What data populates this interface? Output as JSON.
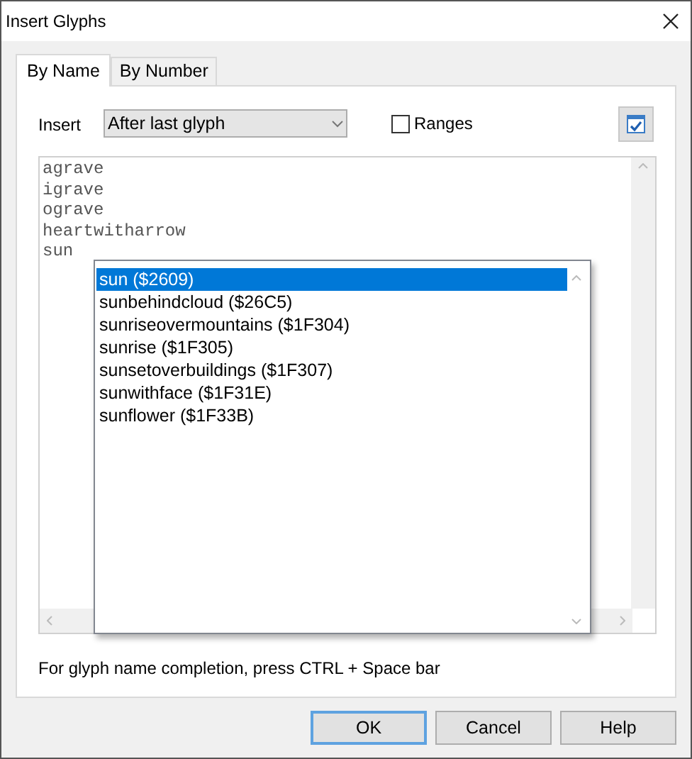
{
  "window": {
    "title": "Insert Glyphs"
  },
  "tabs": [
    {
      "label": "By Name",
      "selected": true
    },
    {
      "label": "By Number",
      "selected": false
    }
  ],
  "insert": {
    "label": "Insert",
    "value": "After last glyph"
  },
  "ranges": {
    "label": "Ranges",
    "checked": false
  },
  "editor": {
    "lines": [
      "agrave",
      "igrave",
      "ograve",
      "heartwitharrow",
      "sun"
    ]
  },
  "completion": {
    "items": [
      {
        "label": "sun ($2609)",
        "selected": true
      },
      {
        "label": "sunbehindcloud ($26C5)",
        "selected": false
      },
      {
        "label": "sunriseovermountains ($1F304)",
        "selected": false
      },
      {
        "label": "sunrise ($1F305)",
        "selected": false
      },
      {
        "label": "sunsetoverbuildings ($1F307)",
        "selected": false
      },
      {
        "label": "sunwithface ($1F31E)",
        "selected": false
      },
      {
        "label": "sunflower ($1F33B)",
        "selected": false
      }
    ]
  },
  "hint": "For glyph name completion, press CTRL + Space bar",
  "buttons": [
    {
      "label": "OK",
      "default": true
    },
    {
      "label": "Cancel",
      "default": false
    },
    {
      "label": "Help",
      "default": false
    }
  ]
}
